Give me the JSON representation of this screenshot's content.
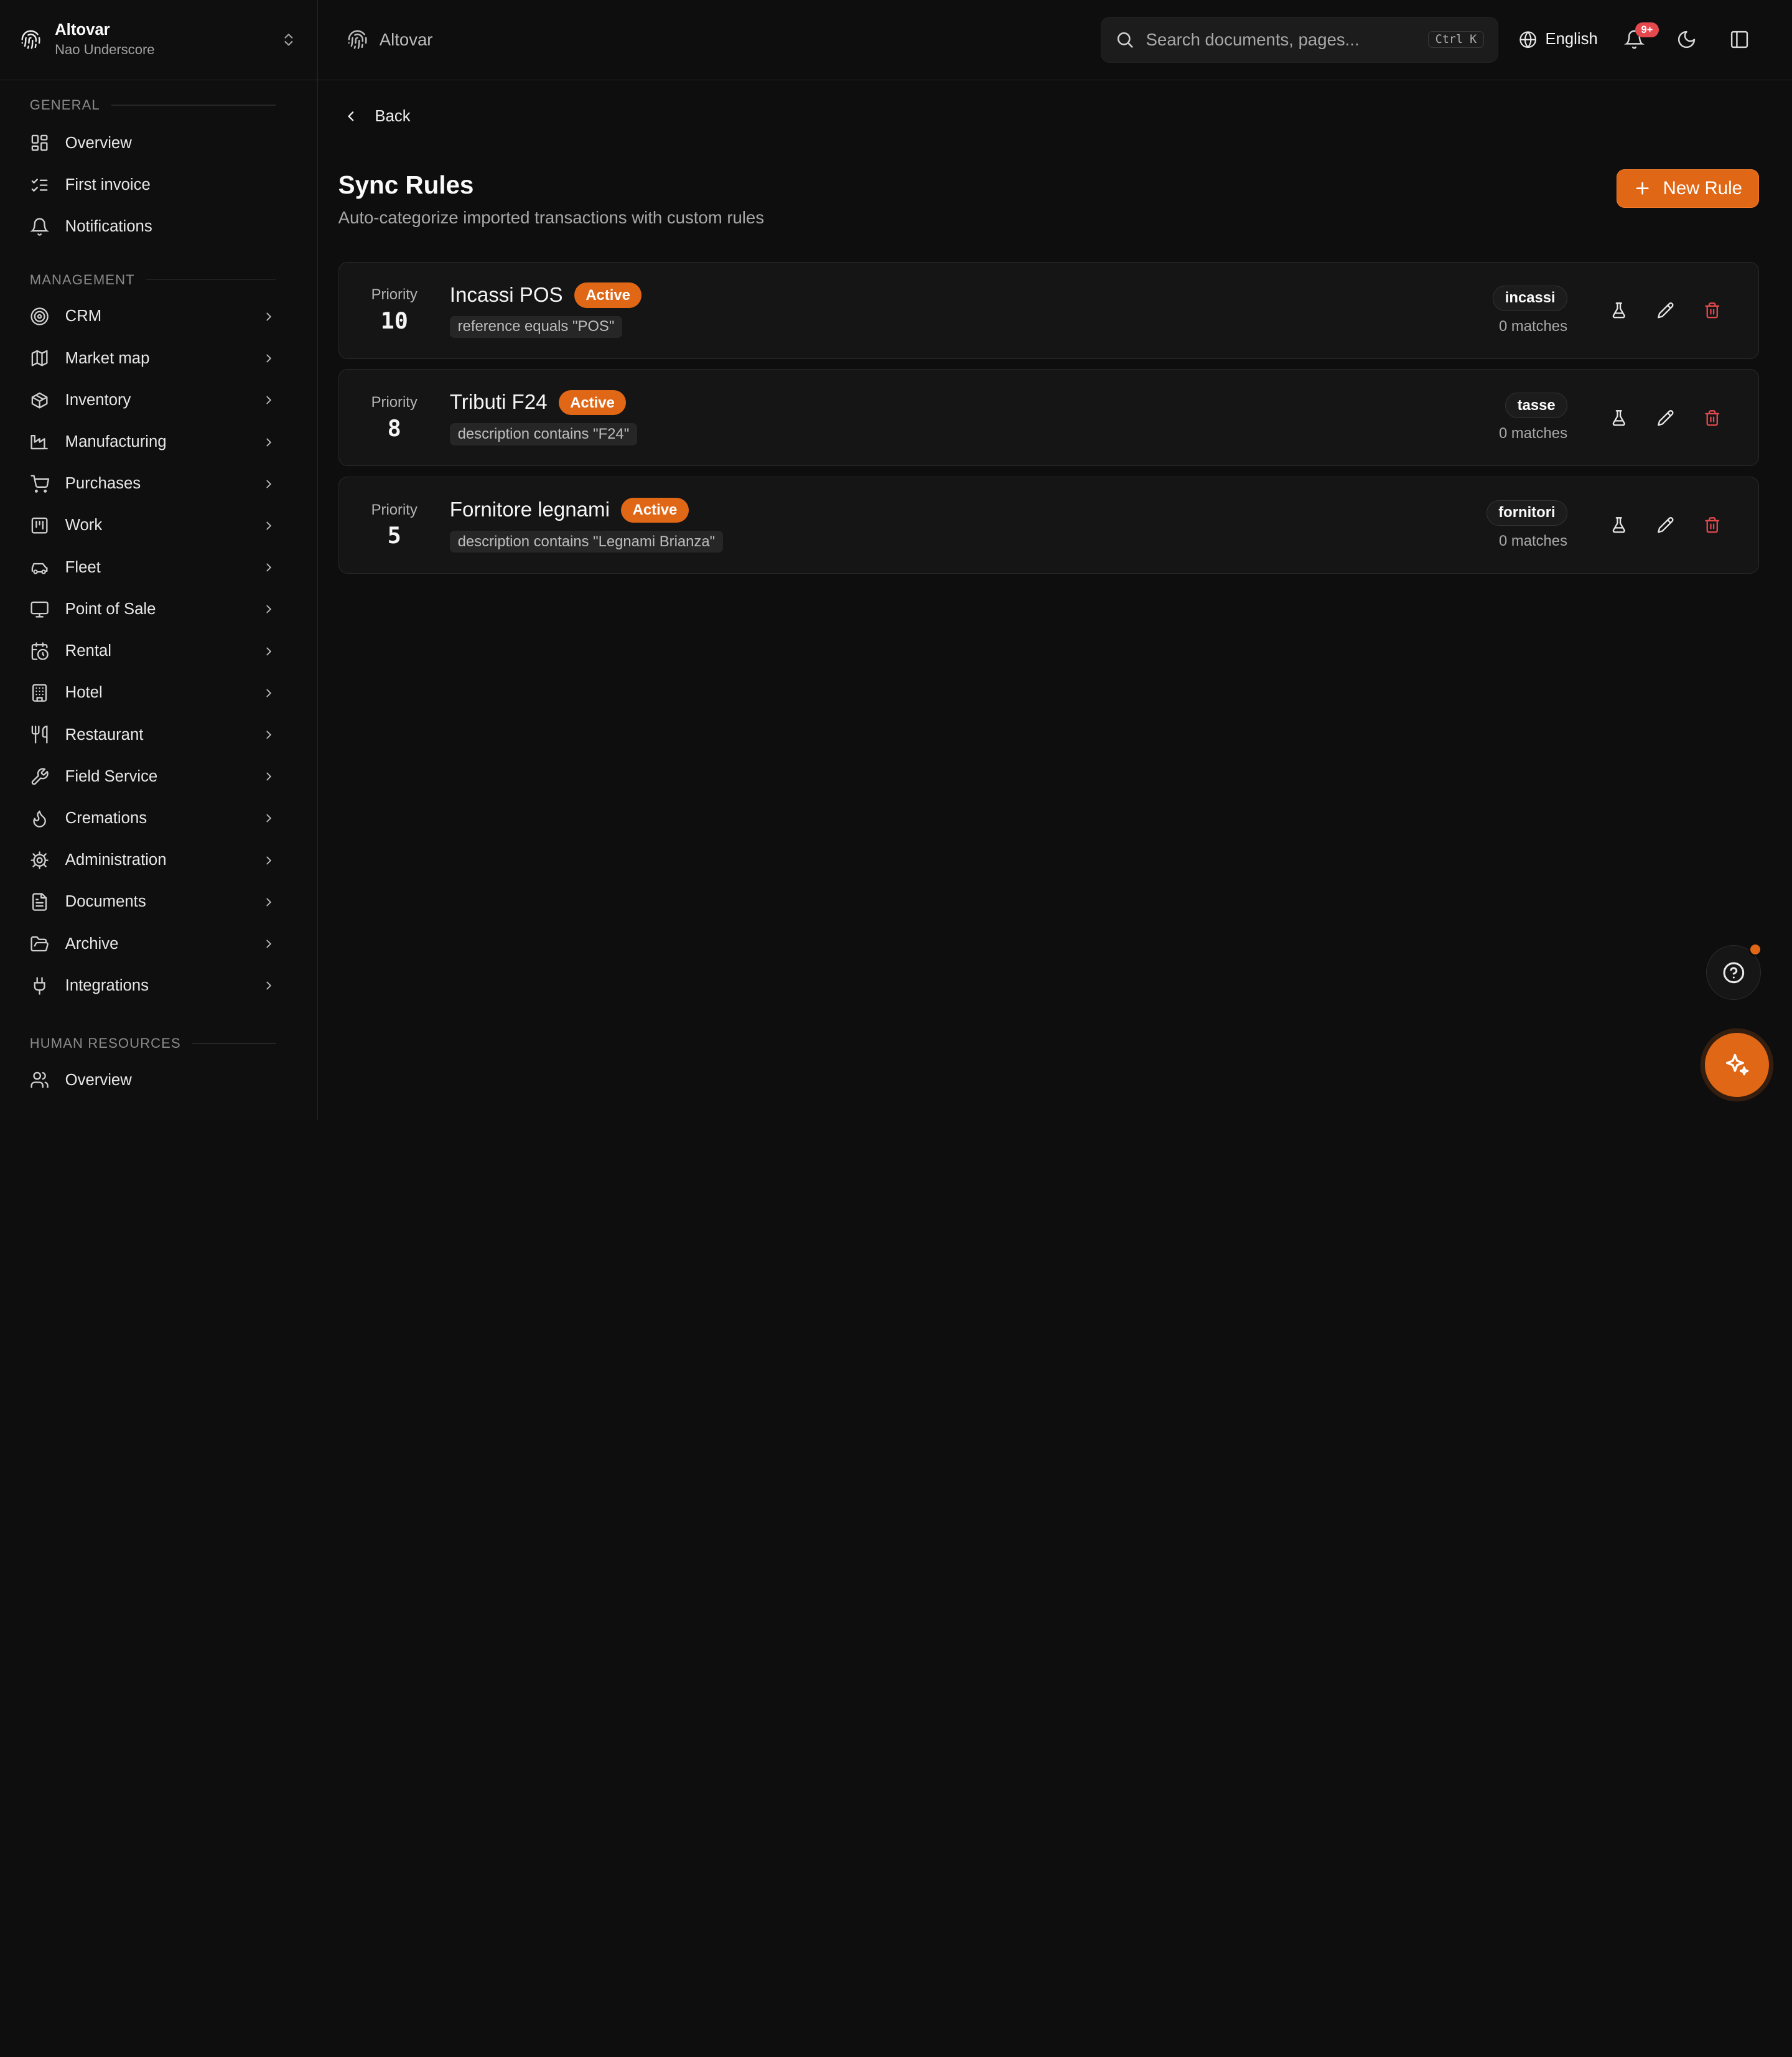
{
  "org": {
    "name": "Altovar",
    "user": "Nao Underscore"
  },
  "sidebar": {
    "sections": [
      {
        "label": "General",
        "items": [
          {
            "label": "Overview",
            "icon": "dashboard-icon"
          },
          {
            "label": "First invoice",
            "icon": "checklist-icon"
          },
          {
            "label": "Notifications",
            "icon": "bell-icon"
          }
        ]
      },
      {
        "label": "Management",
        "items": [
          {
            "label": "CRM",
            "icon": "target-icon"
          },
          {
            "label": "Market map",
            "icon": "map-icon"
          },
          {
            "label": "Inventory",
            "icon": "package-icon"
          },
          {
            "label": "Manufacturing",
            "icon": "factory-icon"
          },
          {
            "label": "Purchases",
            "icon": "cart-icon"
          },
          {
            "label": "Work",
            "icon": "kanban-icon"
          },
          {
            "label": "Fleet",
            "icon": "car-icon"
          },
          {
            "label": "Point of Sale",
            "icon": "monitor-icon"
          },
          {
            "label": "Rental",
            "icon": "calendar-clock-icon"
          },
          {
            "label": "Hotel",
            "icon": "building-icon"
          },
          {
            "label": "Restaurant",
            "icon": "utensils-icon"
          },
          {
            "label": "Field Service",
            "icon": "wrench-icon"
          },
          {
            "label": "Cremations",
            "icon": "flame-icon"
          },
          {
            "label": "Administration",
            "icon": "gear-icon"
          },
          {
            "label": "Documents",
            "icon": "file-icon"
          },
          {
            "label": "Archive",
            "icon": "folder-open-icon"
          },
          {
            "label": "Integrations",
            "icon": "plug-icon"
          }
        ]
      },
      {
        "label": "Human Resources",
        "items": [
          {
            "label": "Overview",
            "icon": "users-icon"
          }
        ]
      }
    ]
  },
  "header": {
    "breadcrumb": "Altovar",
    "search": {
      "placeholder": "Search documents, pages...",
      "shortcut": "Ctrl K"
    },
    "language": "English",
    "notifications_badge": "9+"
  },
  "main": {
    "back_label": "Back",
    "title": "Sync Rules",
    "subtitle": "Auto-categorize imported transactions with custom rules",
    "new_rule_label": "New Rule",
    "priority_label": "Priority",
    "rules": [
      {
        "priority": "10",
        "name": "Incassi POS",
        "status": "Active",
        "condition": "reference equals \"POS\"",
        "tag": "incassi",
        "matches": "0 matches"
      },
      {
        "priority": "8",
        "name": "Tributi F24",
        "status": "Active",
        "condition": "description contains \"F24\"",
        "tag": "tasse",
        "matches": "0 matches"
      },
      {
        "priority": "5",
        "name": "Fornitore legnami",
        "status": "Active",
        "condition": "description contains \"Legnami Brianza\"",
        "tag": "fornitori",
        "matches": "0 matches"
      }
    ]
  },
  "colors": {
    "accent": "#e06716",
    "danger": "#e5484d",
    "background": "#0e0e0e"
  }
}
